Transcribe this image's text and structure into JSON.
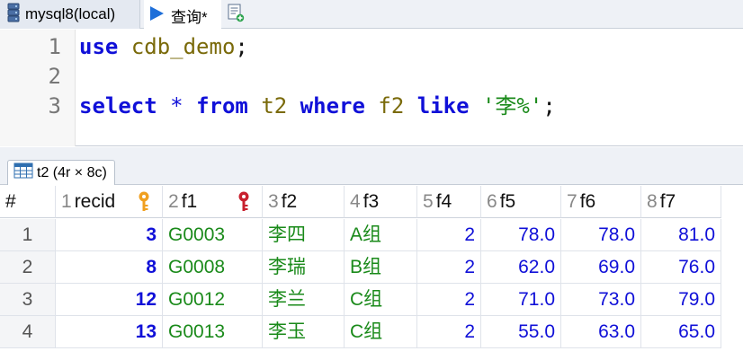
{
  "tabs": {
    "connection_label": "mysql8(local)",
    "query_label": "查询*"
  },
  "editor": {
    "lines": [
      {
        "num": "1",
        "tokens": [
          [
            "kw",
            "use"
          ],
          [
            "pun",
            " "
          ],
          [
            "id",
            "cdb_demo"
          ],
          [
            "pun",
            ";"
          ]
        ]
      },
      {
        "num": "2",
        "tokens": []
      },
      {
        "num": "3",
        "tokens": [
          [
            "kw",
            "select"
          ],
          [
            "pun",
            " "
          ],
          [
            "op",
            "*"
          ],
          [
            "pun",
            " "
          ],
          [
            "kw",
            "from"
          ],
          [
            "pun",
            " "
          ],
          [
            "id",
            "t2"
          ],
          [
            "pun",
            " "
          ],
          [
            "kw",
            "where"
          ],
          [
            "pun",
            " "
          ],
          [
            "id",
            "f2"
          ],
          [
            "pun",
            " "
          ],
          [
            "kw",
            "like"
          ],
          [
            "pun",
            " "
          ],
          [
            "str",
            "'李%'"
          ],
          [
            "pun",
            ";"
          ]
        ]
      }
    ]
  },
  "result_tab": {
    "label": "t2 (4r × 8c)"
  },
  "grid": {
    "rownum_header": "#",
    "columns": [
      {
        "num": "1",
        "name": "recid",
        "key": "primary-key"
      },
      {
        "num": "2",
        "name": "f1",
        "key": "foreign-key"
      },
      {
        "num": "3",
        "name": "f2"
      },
      {
        "num": "4",
        "name": "f3"
      },
      {
        "num": "5",
        "name": "f4"
      },
      {
        "num": "6",
        "name": "f5"
      },
      {
        "num": "7",
        "name": "f6"
      },
      {
        "num": "8",
        "name": "f7"
      }
    ],
    "rows": [
      {
        "rownum": "1",
        "cells": [
          "3",
          "G0003",
          "李四",
          "A组",
          "2",
          "78.0",
          "78.0",
          "81.0"
        ]
      },
      {
        "rownum": "2",
        "cells": [
          "8",
          "G0008",
          "李瑞",
          "B组",
          "2",
          "62.0",
          "69.0",
          "76.0"
        ]
      },
      {
        "rownum": "3",
        "cells": [
          "12",
          "G0012",
          "李兰",
          "C组",
          "2",
          "71.0",
          "73.0",
          "79.0"
        ]
      },
      {
        "rownum": "4",
        "cells": [
          "13",
          "G0013",
          "李玉",
          "C组",
          "2",
          "55.0",
          "63.0",
          "65.0"
        ]
      }
    ]
  },
  "colors": {
    "keyword": "#1010d8",
    "identifier": "#7a6a0a",
    "string": "#1a8a1a",
    "primary_key_icon": "#f0a020",
    "foreign_key_icon": "#c8202e"
  }
}
